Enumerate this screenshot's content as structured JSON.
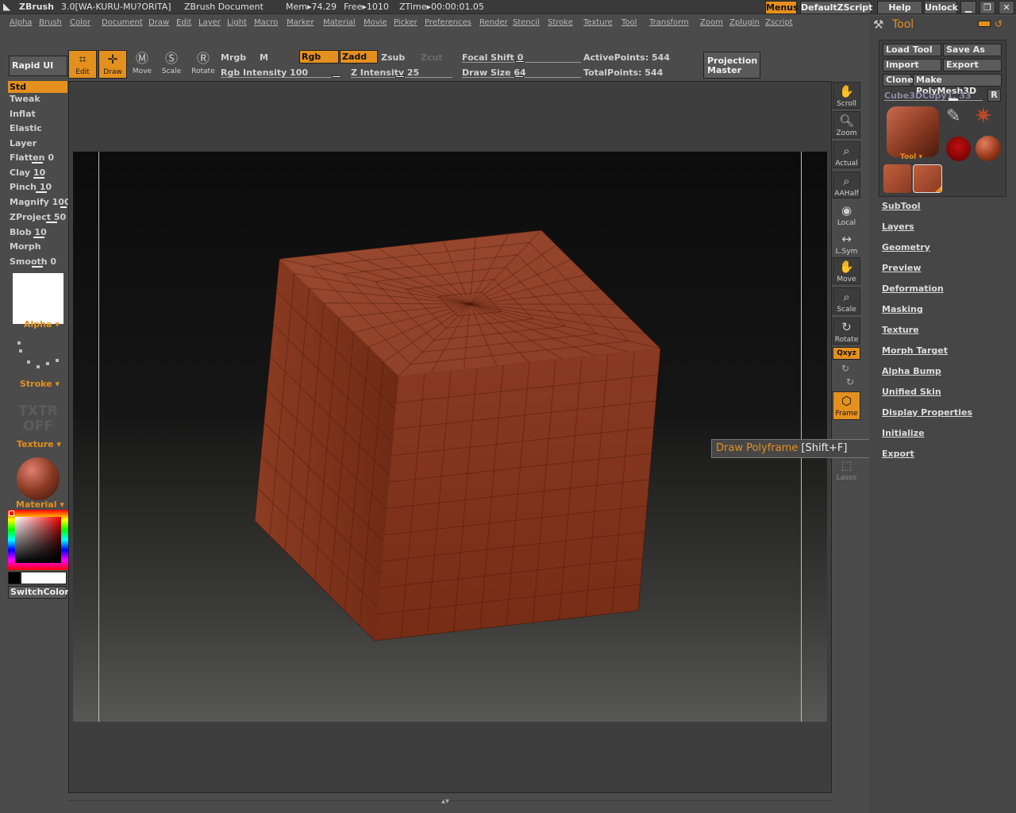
{
  "titlebar": {
    "app": "ZBrush",
    "version": "3.0[WA-KURU-MU?ORITA]",
    "document": "ZBrush Document",
    "mem": "Mem▸74.29",
    "free": "Free▸1010",
    "ztime": "ZTime▸00:00:01.05",
    "buttons": [
      "Menus",
      "DefaultZScript",
      "Help",
      "Unlock"
    ]
  },
  "menus": [
    "Alpha",
    "Brush",
    "Color",
    "Document",
    "Draw",
    "Edit",
    "Layer",
    "Light",
    "Macro",
    "Marker",
    "Material",
    "Movie",
    "Picker",
    "Preferences",
    "Render",
    "Stencil",
    "Stroke",
    "Texture",
    "Tool",
    "Transform",
    "Zoom",
    "Zplugin",
    "Zscript"
  ],
  "shelf": {
    "rapid_ui": "Rapid UI",
    "edit": "Edit",
    "draw": "Draw",
    "move": "Move",
    "scale": "Scale",
    "rotate": "Rotate",
    "mrgb": "Mrgb",
    "m": "M",
    "rgb": "Rgb",
    "zadd": "Zadd",
    "zsub": "Zsub",
    "zcut": "Zcut",
    "rgb_intensity": "Rgb Intensity 100",
    "z_intensity": "Z Intensity 25",
    "focal_shift": "Focal Shift 0",
    "draw_size": "Draw Size 64",
    "active_points": "ActivePoints: 544",
    "total_points": "TotalPoints: 544",
    "projection_master": "Projection Master"
  },
  "brushes": [
    "Std",
    "Tweak",
    "Inflat",
    "Elastic",
    "Layer",
    "Flatten 0",
    "Clay 10",
    "Pinch 10",
    "Magnify 100",
    "ZProject 50",
    "Blob 10",
    "Morph",
    "Smooth 0"
  ],
  "left": {
    "alpha": "Alpha",
    "stroke": "Stroke",
    "texture": "Texture",
    "txtr": "TXTR",
    "off": "OFF",
    "material": "Material",
    "switchcolor": "SwitchColor"
  },
  "righttools": [
    "Scroll",
    "Zoom",
    "Actual",
    "AAHalf",
    "Local",
    "L.Sym",
    "Move",
    "Scale",
    "Rotate",
    "Qxyz",
    "Frame",
    "Lasso"
  ],
  "tooltip": {
    "text": "Draw Polyframe",
    "shortcut": "[Shift+F]"
  },
  "toolpanel": {
    "title": "Tool",
    "load": "Load Tool",
    "save": "Save As",
    "import": "Import",
    "export": "Export",
    "clone": "Clone",
    "make_polymesh": "Make PolyMesh3D",
    "current": "Cube3DCopy1. 33",
    "r": "R",
    "tool_label": "Tool",
    "sections": [
      "SubTool",
      "Layers",
      "Geometry",
      "Preview",
      "Deformation",
      "Masking",
      "Texture",
      "Morph Target",
      "Alpha Bump",
      "Unified Skin",
      "Display Properties",
      "Initialize",
      "Export"
    ]
  },
  "colors": {
    "accent": "#e4901e",
    "cube": "#8a3a22",
    "bg": "#4b4b4b"
  }
}
